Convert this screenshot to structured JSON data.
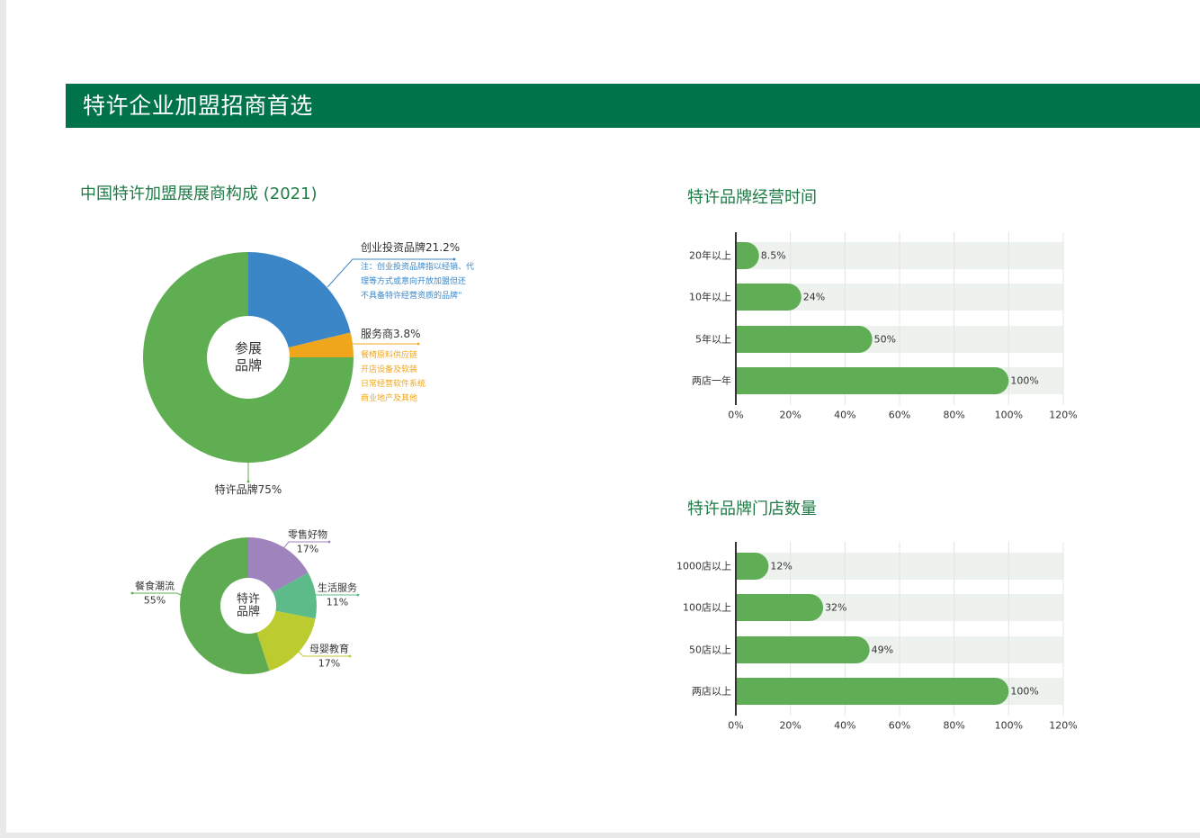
{
  "page": {
    "banner_title": "特许企业加盟招商首选",
    "colors": {
      "banner": "#00734a",
      "section_title": "#1f7b45",
      "text": "#333333"
    }
  },
  "chart_data": [
    {
      "type": "pie",
      "title": "中国特许加盟展展商构成 (2021)",
      "center_label": [
        "参展",
        "品牌"
      ],
      "unit": "%",
      "slices": [
        {
          "label": "创业投资品牌",
          "value": 21.2,
          "color": "#3b86c6",
          "note": [
            "注：创业投资品牌指以经销、代",
            "理等方式或意向开放加盟但还",
            "不具备特许经营资质的品牌”"
          ]
        },
        {
          "label": "服务商",
          "value": 3.8,
          "color": "#f0a61c",
          "note": [
            "餐椅原料供应链",
            "开店设备及软装",
            "日常经营软件系统",
            "商业地产及其他"
          ]
        },
        {
          "label": "特许品牌",
          "value": 75,
          "color": "#60ae52"
        }
      ]
    },
    {
      "type": "pie",
      "center_label": [
        "特许",
        "品牌"
      ],
      "unit": "%",
      "slices": [
        {
          "label": "零售好物",
          "value": 17,
          "color": "#9e83bd"
        },
        {
          "label": "生活服务",
          "value": 11,
          "color": "#5cbb88"
        },
        {
          "label": "母婴教育",
          "value": 17,
          "color": "#bccb2f"
        },
        {
          "label": "餐食潮流",
          "value": 55,
          "color": "#5fab51"
        }
      ]
    },
    {
      "type": "bar",
      "orientation": "horizontal",
      "title": "特许品牌经营时间",
      "categories": [
        "20年以上",
        "10年以上",
        "5年以上",
        "两店一年"
      ],
      "values": [
        8.5,
        24,
        50,
        100
      ],
      "unit": "%",
      "xlim": [
        0,
        120
      ],
      "xticks": [
        0,
        20,
        40,
        60,
        80,
        100,
        120
      ],
      "grid": true,
      "bar_color": "#5fae56",
      "track_color": "#eef2ee"
    },
    {
      "type": "bar",
      "orientation": "horizontal",
      "title": "特许品牌门店数量",
      "categories": [
        "1000店以上",
        "100店以上",
        "50店以上",
        "两店以上"
      ],
      "values": [
        12,
        32,
        49,
        100
      ],
      "unit": "%",
      "xlim": [
        0,
        120
      ],
      "xticks": [
        0,
        20,
        40,
        60,
        80,
        100,
        120
      ],
      "grid": true,
      "bar_color": "#5fae56",
      "track_color": "#eef2ee"
    }
  ]
}
